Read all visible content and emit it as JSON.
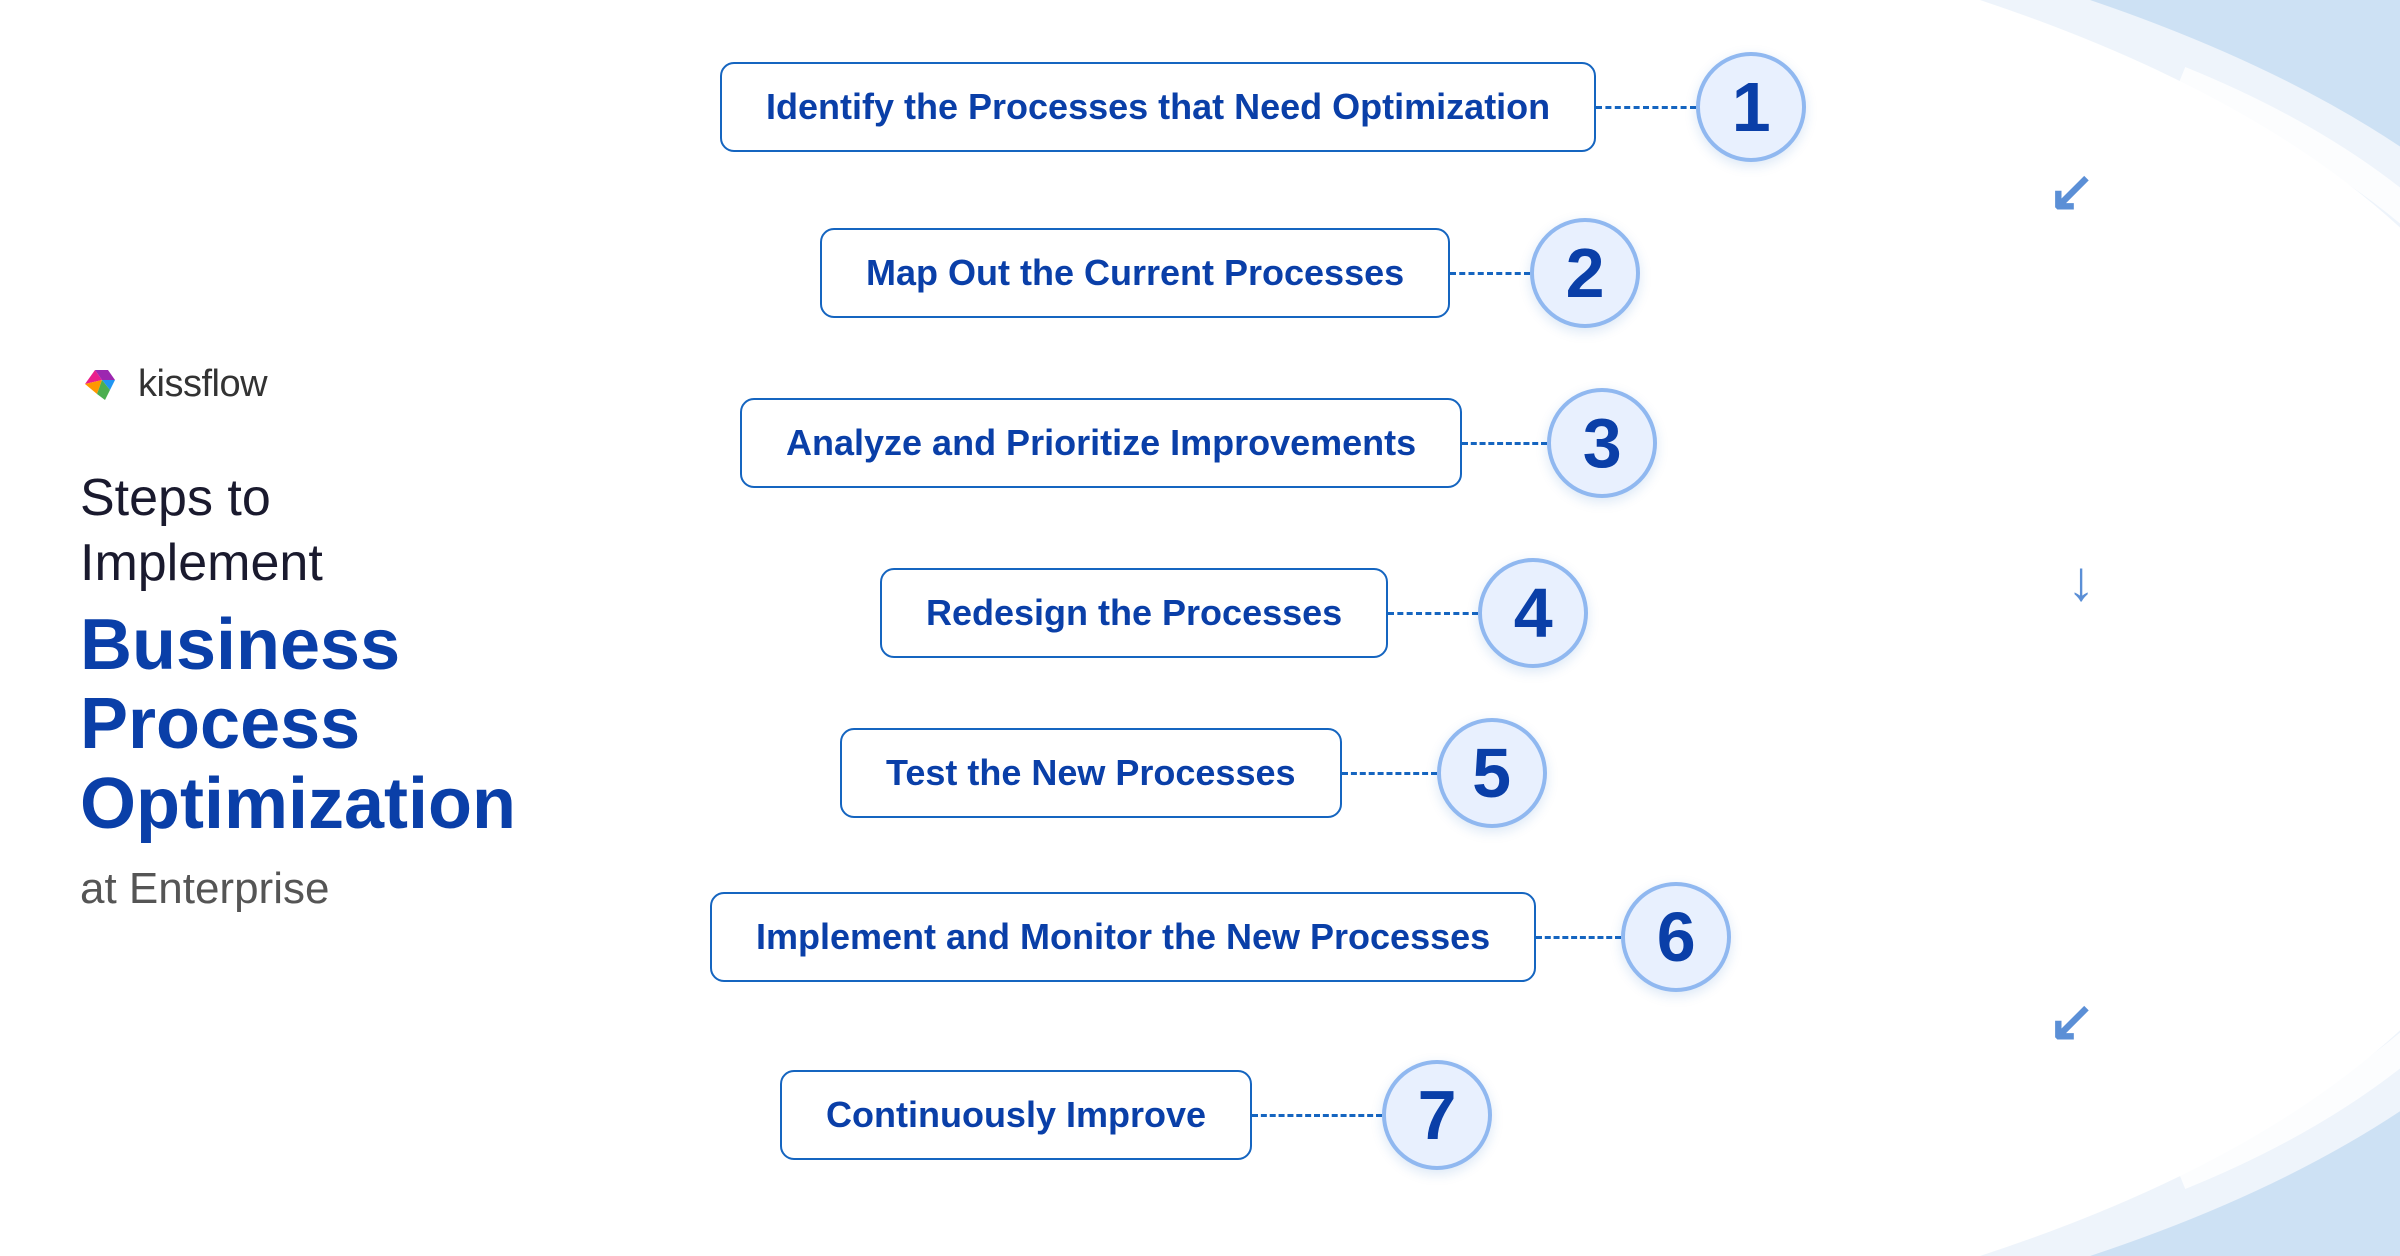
{
  "logo": {
    "text": "kissflow"
  },
  "heading": {
    "subtitle": "Steps to\nImplement",
    "title_bold": "Business Process\nOptimization",
    "at": "at Enterprise"
  },
  "steps": [
    {
      "number": "1",
      "label": "Identify the Processes that Need Optimization"
    },
    {
      "number": "2",
      "label": "Map Out the Current Processes"
    },
    {
      "number": "3",
      "label": "Analyze and Prioritize Improvements"
    },
    {
      "number": "4",
      "label": "Redesign the Processes"
    },
    {
      "number": "5",
      "label": "Test the New Processes"
    },
    {
      "number": "6",
      "label": "Implement and Monitor the New Processes"
    },
    {
      "number": "7",
      "label": "Continuously Improve"
    }
  ],
  "colors": {
    "accent": "#0a3fa8",
    "border": "#1565c0",
    "bg_curve": "#b8d4f0",
    "circle_bg": "#e8f0fe"
  }
}
